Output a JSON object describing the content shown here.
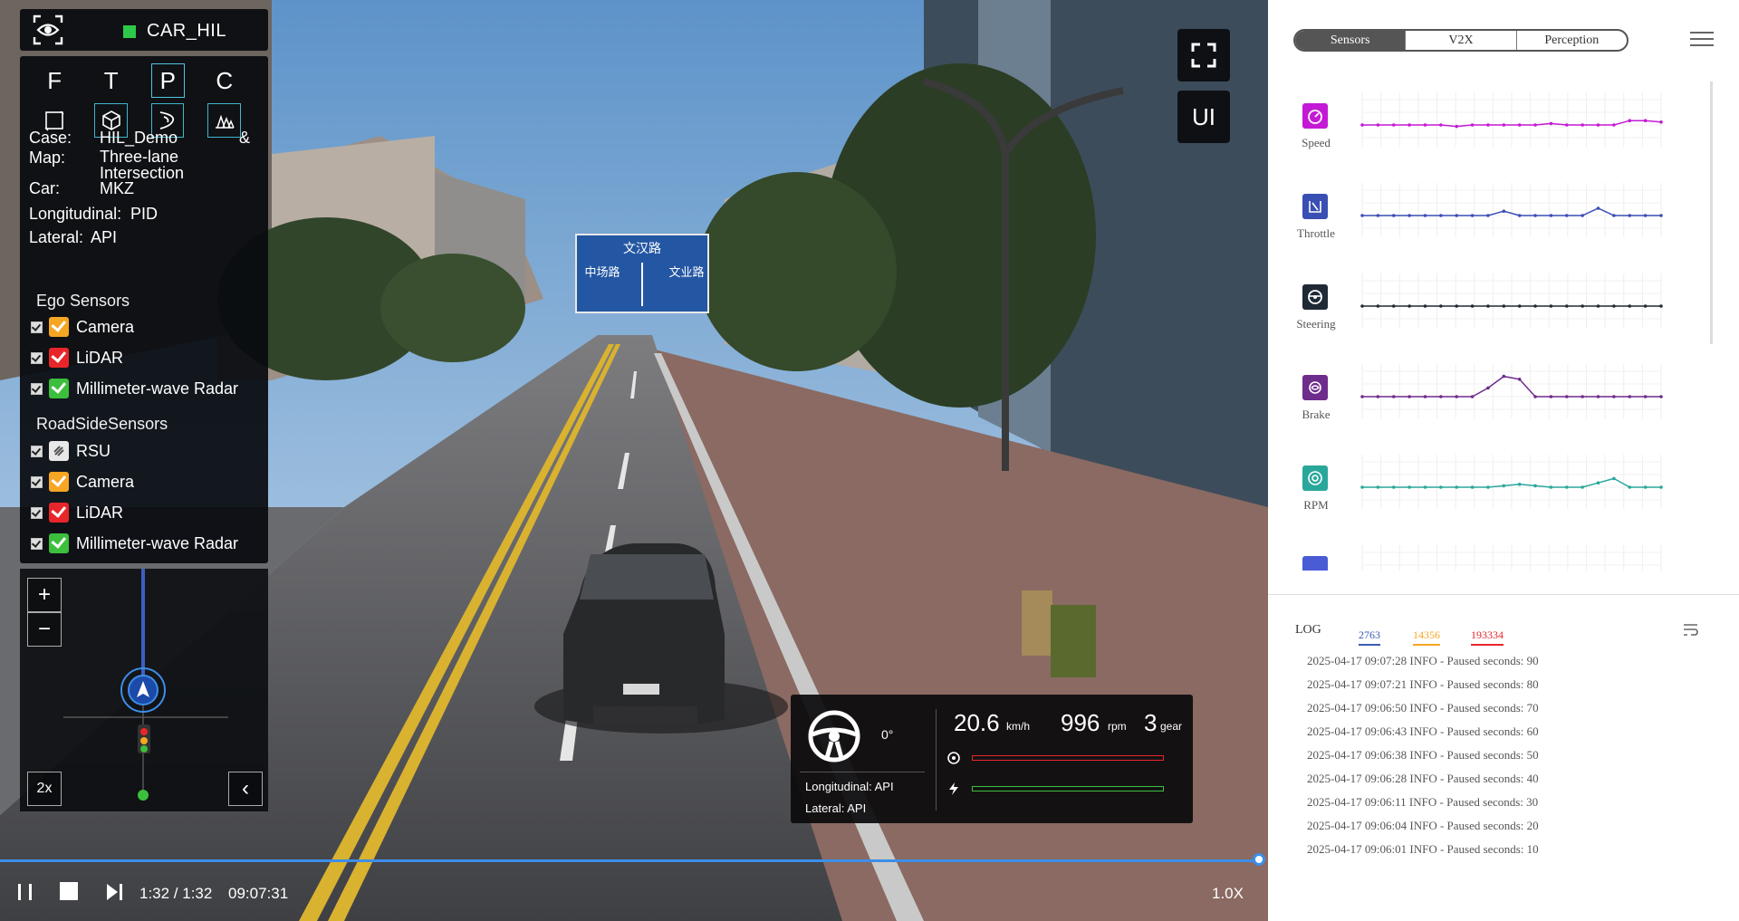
{
  "app": {
    "title": "CAR_HIL",
    "status_color": "#2fc94a"
  },
  "views": {
    "front": "F",
    "top": "T",
    "perspective": "P",
    "chase": "C"
  },
  "view_icons": [
    "box-outline-icon",
    "cube-icon",
    "road-curve-icon",
    "grid-terrain-icon"
  ],
  "info": [
    {
      "label": "Case:",
      "value": "HIL_Demo"
    },
    {
      "label": "Map:",
      "value": "Three-lane Intersection"
    },
    {
      "label": "Car:",
      "value": "MKZ"
    },
    {
      "label": "Longitudinal:",
      "value": "PID"
    },
    {
      "label": "Lateral:",
      "value": "API"
    }
  ],
  "ego_sensors": {
    "title": "Ego Sensors",
    "items": [
      {
        "label": "Camera",
        "color": "#f5a623"
      },
      {
        "label": "LiDAR",
        "color": "#e8262a"
      },
      {
        "label": "Millimeter-wave Radar",
        "color": "#3cbf3c"
      }
    ]
  },
  "roadside_sensors": {
    "title": "RoadSideSensors",
    "items": [
      {
        "label": "RSU",
        "color": "#e8e8e8"
      },
      {
        "label": "Camera",
        "color": "#f5a623"
      },
      {
        "label": "LiDAR",
        "color": "#e8262a"
      },
      {
        "label": "Millimeter-wave Radar",
        "color": "#3cbf3c"
      }
    ]
  },
  "minimap": {
    "zoom_in": "+",
    "zoom_out": "−",
    "scale": "2x",
    "collapse": "‹"
  },
  "float_buttons": {
    "ui": "UI"
  },
  "road_sign": {
    "top": "文汉路",
    "left": "中场路",
    "right": "文业路"
  },
  "hud": {
    "steering_angle": "0°",
    "speed": "20.6",
    "speed_unit": "km/h",
    "rpm": "996",
    "rpm_unit": "rpm",
    "gear": "3",
    "gear_unit": "gear",
    "longitudinal": "Longitudinal: API",
    "lateral": "Lateral: API",
    "brake_color": "#e8262a",
    "throttle_color": "#3cbf3c"
  },
  "player": {
    "time": "1:32 / 1:32",
    "clock": "09:07:31",
    "speed": "1.0X",
    "progress": 1.0,
    "accent": "#3d8ee8"
  },
  "tabs": [
    "Sensors",
    "V2X",
    "Perception"
  ],
  "metrics": [
    {
      "label": "Speed",
      "icon": "speedometer-icon",
      "color": "#c41ad6"
    },
    {
      "label": "Throttle",
      "icon": "throttle-icon",
      "color": "#3a4fb3"
    },
    {
      "label": "Steering",
      "icon": "steering-wheel-icon",
      "color": "#1f2a36"
    },
    {
      "label": "Brake",
      "icon": "brake-icon",
      "color": "#6e2c8c"
    },
    {
      "label": "RPM",
      "icon": "rpm-icon",
      "color": "#2aa79b"
    }
  ],
  "log": {
    "title": "LOG",
    "counts": [
      {
        "value": "2763",
        "color": "#3a5ab3"
      },
      {
        "value": "14356",
        "color": "#f5a623"
      },
      {
        "value": "193334",
        "color": "#e8262a"
      }
    ],
    "lines": [
      "2025-04-17 09:07:28 INFO - Paused seconds: 90",
      "2025-04-17 09:07:21 INFO - Paused seconds: 80",
      "2025-04-17 09:06:50 INFO - Paused seconds: 70",
      "2025-04-17 09:06:43 INFO - Paused seconds: 60",
      "2025-04-17 09:06:38 INFO - Paused seconds: 50",
      "2025-04-17 09:06:28 INFO - Paused seconds: 40",
      "2025-04-17 09:06:11 INFO - Paused seconds: 30",
      "2025-04-17 09:06:04 INFO - Paused seconds: 20",
      "2025-04-17 09:06:01 INFO - Paused seconds: 10"
    ]
  }
}
